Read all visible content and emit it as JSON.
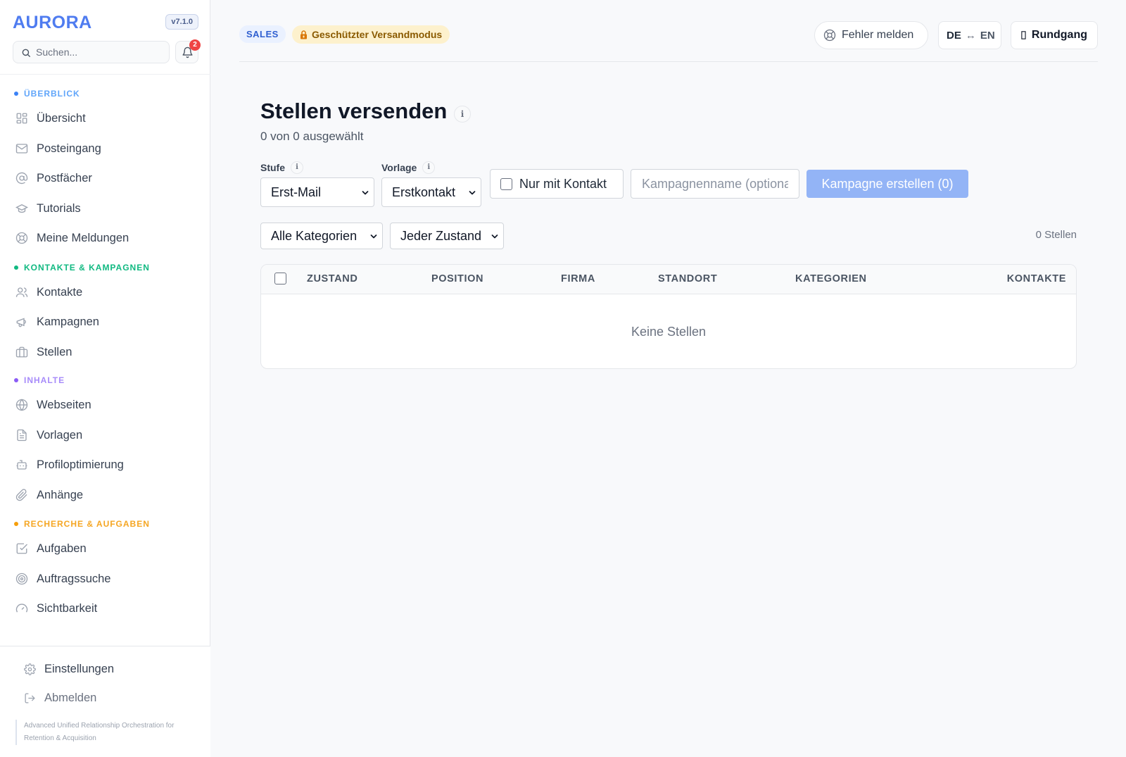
{
  "app": {
    "brand": "AURORA",
    "version": "v7.1.0",
    "tagline": "Advanced Unified Relationship Orchestration for Retention & Acquisition"
  },
  "search": {
    "placeholder": "Suchen..."
  },
  "notifications": {
    "count": "2"
  },
  "sidebar": {
    "sections": [
      {
        "label": "ÜBERBLICK",
        "color": "#3b82f6"
      },
      {
        "label": "KONTAKTE & KAMPAGNEN",
        "color": "#10b981"
      },
      {
        "label": "INHALTE",
        "color": "#8b5cf6"
      },
      {
        "label": "RECHERCHE & AUFGABEN",
        "color": "#f59e0b"
      }
    ],
    "items": [
      {
        "label": "Übersicht",
        "icon": "grid-icon"
      },
      {
        "label": "Posteingang",
        "icon": "mail-icon"
      },
      {
        "label": "Postfächer",
        "icon": "at-icon"
      },
      {
        "label": "Tutorials",
        "icon": "graduation-cap-icon"
      },
      {
        "label": "Meine Meldungen",
        "icon": "lifebuoy-icon"
      },
      {
        "label": "Kontakte",
        "icon": "users-icon"
      },
      {
        "label": "Kampagnen",
        "icon": "megaphone-icon"
      },
      {
        "label": "Stellen",
        "icon": "briefcase-icon"
      },
      {
        "label": "Webseiten",
        "icon": "globe-icon"
      },
      {
        "label": "Vorlagen",
        "icon": "file-text-icon"
      },
      {
        "label": "Profiloptimierung",
        "icon": "bot-icon"
      },
      {
        "label": "Anhänge",
        "icon": "paperclip-icon"
      },
      {
        "label": "Aufgaben",
        "icon": "check-square-icon"
      },
      {
        "label": "Auftragssuche",
        "icon": "target-icon"
      },
      {
        "label": "Sichtbarkeit",
        "icon": "gauge-icon"
      }
    ],
    "bottom": {
      "settings": "Einstellungen",
      "logout": "Abmelden"
    }
  },
  "topbar": {
    "sales_chip": "SALES",
    "protected_chip": "Geschützter Versandmodus",
    "report_button": "Fehler melden",
    "lang_de": "DE",
    "lang_arrow": "↔",
    "lang_en": "EN",
    "tour_button": "Rundgang"
  },
  "main": {
    "title": "Stellen versenden",
    "subtitle": "0 von 0 ausgewählt",
    "stufe_label": "Stufe",
    "stufe_value": "Erst-Mail",
    "vorlage_label": "Vorlage",
    "vorlage_value": "Erstkontakt",
    "contact_only_label": "Nur mit Kontakt",
    "campaign_placeholder": "Kampagnenname (optional)",
    "create_button": "Kampagne erstellen (0)",
    "category_filter": "Alle Kategorien",
    "state_filter": "Jeder Zustand",
    "count": "0 Stellen"
  },
  "table": {
    "columns": [
      "ZUSTAND",
      "POSITION",
      "FIRMA",
      "STANDORT",
      "KATEGORIEN",
      "KONTAKTE"
    ],
    "empty_text": "Keine Stellen"
  },
  "colors": {
    "accent": "#4f7cf0",
    "create_disabled": "#93b4f6",
    "protected_bg": "#fdf1cd",
    "badge": "#ef4444"
  }
}
